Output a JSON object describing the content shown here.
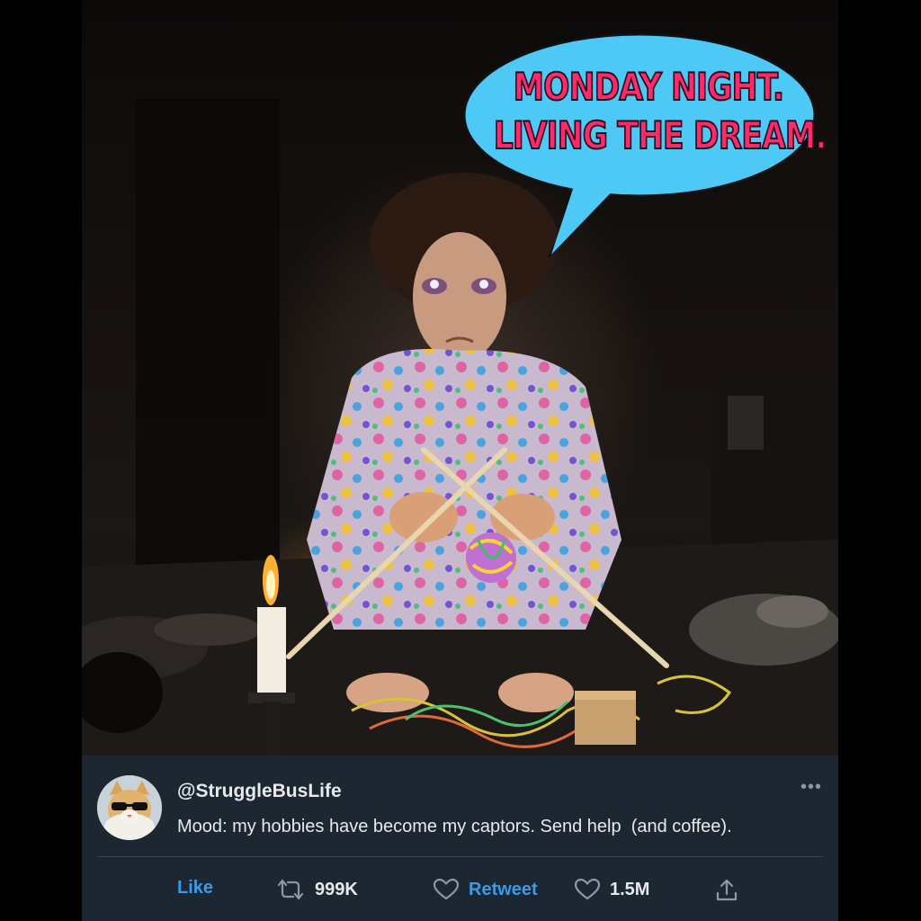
{
  "meme": {
    "caption_line1": "MONDAY NIGHT.",
    "caption_line2": "LIVING THE DREAM."
  },
  "tweet": {
    "handle": "@StruggleBusLife",
    "text": "Mood: my hobbies have become my captors. Send help  (and coffee).",
    "more_label": "•••",
    "actions": {
      "like_label": "Like",
      "retweet_count": "999K",
      "retweet_label": "Retweet",
      "like_count": "1.5M"
    }
  },
  "icons": {
    "avatar": "cat-with-sunglasses-avatar",
    "retweet": "retweet-icon",
    "heart_outline": "heart-icon",
    "like": "like-heart-icon",
    "share": "share-icon",
    "more": "more-dots-icon"
  },
  "colors": {
    "card_bg": "#1c2732",
    "accent_blue": "#3b9be8",
    "bubble_fill": "#4ec8f4",
    "caption_pink": "#ff2a6d"
  }
}
